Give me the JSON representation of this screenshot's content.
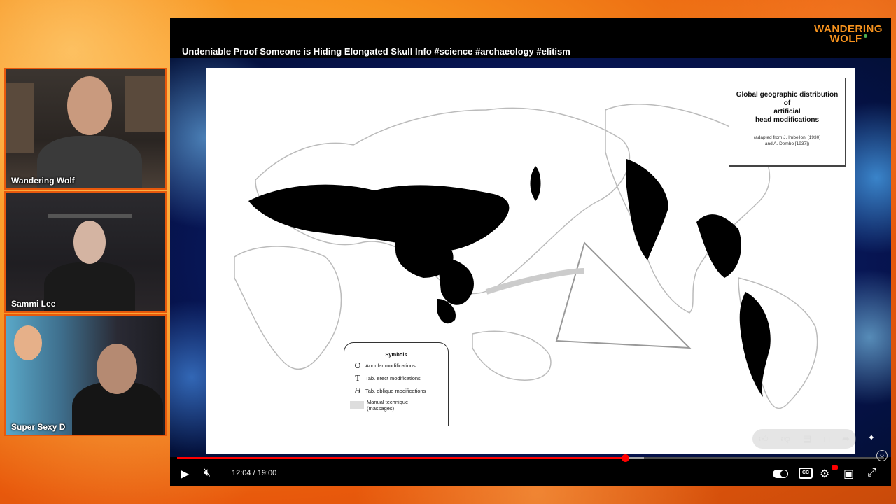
{
  "participants": [
    {
      "name": "Wandering Wolf"
    },
    {
      "name": "Sammi Lee"
    },
    {
      "name": "Super Sexy D"
    }
  ],
  "player": {
    "title": "Undeniable Proof Someone is Hiding Elongated Skull Info #science #archaeology #elitism",
    "logo_line1": "WANDERING",
    "logo_line2": "WOLF",
    "time": "12:04 / 19:00",
    "progress_fraction": 0.6337,
    "buffer_fraction": 0.66
  },
  "slide": {
    "map_title_line1": "Global geographic distribution",
    "map_title_line2": "of",
    "map_title_line3": "artificial",
    "map_title_line4": "head modifications",
    "map_source_line1": "(adapted from J. Imbelloni [1930]",
    "map_source_line2": "and A. Dembo [1937])",
    "legend_title": "Symbols",
    "legend_items": [
      {
        "symbol": "O",
        "label": "Annular modifications"
      },
      {
        "symbol": "T",
        "label": "Tab. erect modifications"
      },
      {
        "symbol": "H",
        "label": "Tab. oblique modifications"
      },
      {
        "symbol": "",
        "label": "Manual technique",
        "sublabel": "(massages)"
      }
    ]
  },
  "icons": {
    "like": "thumbs-up-icon",
    "dislike": "thumbs-down-icon",
    "comment": "comment-icon",
    "share": "share-icon"
  },
  "colors": {
    "accent": "#f7931e",
    "progress": "#ff0000",
    "cam_border": "#e8590c"
  }
}
